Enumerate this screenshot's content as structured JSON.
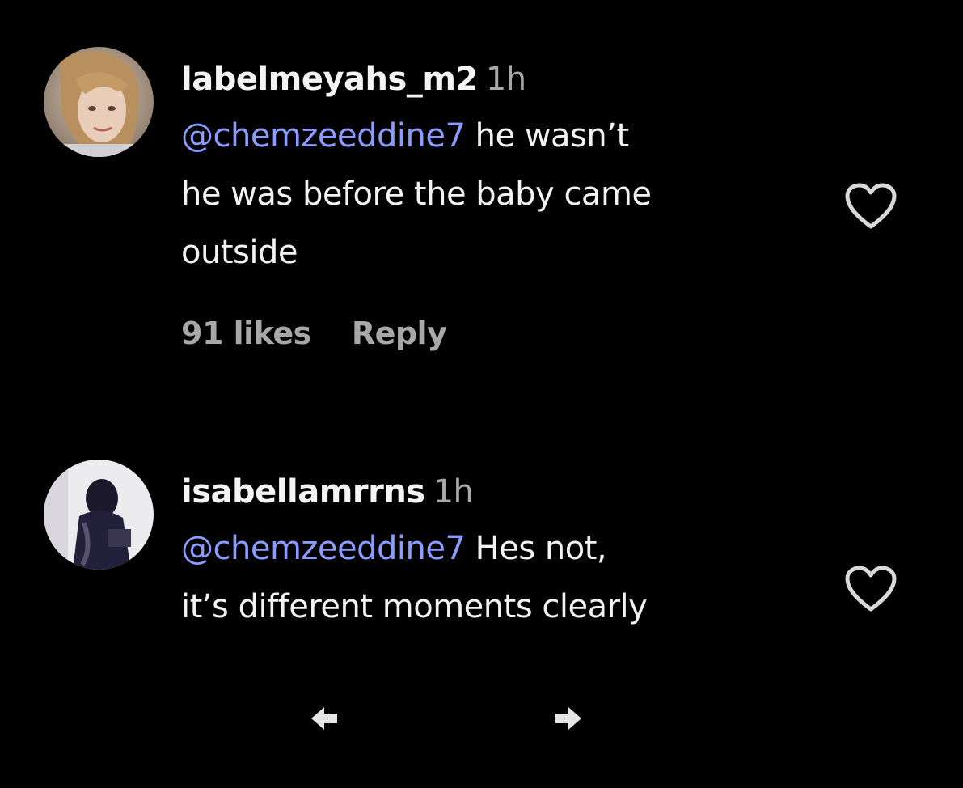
{
  "comments": [
    {
      "username": "labelmeyahs_m2",
      "time": "1h",
      "mention": "@chemzeeddine7",
      "text_first": " he wasn’t",
      "text_lines": [
        "he was before the baby came",
        "outside"
      ],
      "likes": "91 likes",
      "reply": "Reply",
      "avatar_icon": "avatar-photo-woman",
      "like_icon": "heart-outline-icon"
    },
    {
      "username": "isabellamrrns",
      "time": "1h",
      "mention": "@chemzeeddine7",
      "text_first": " Hes not,",
      "text_lines": [
        "it’s different moments clearly"
      ],
      "avatar_icon": "avatar-photo-person",
      "like_icon": "heart-outline-icon"
    }
  ],
  "navigation": {
    "prev_icon": "arrow-left-icon",
    "next_icon": "arrow-right-icon"
  },
  "colors": {
    "background": "#000000",
    "mention": "#8c9bff",
    "secondary_text": "#a8a8a8",
    "primary_text": "#f2f2f2"
  }
}
